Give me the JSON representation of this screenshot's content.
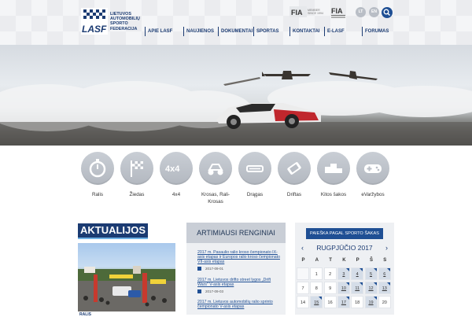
{
  "header": {
    "logo_text": "LASF",
    "org_lines": [
      "LIETUVOS",
      "AUTOMOBILIŲ",
      "SPORTO",
      "FEDERACIJA"
    ],
    "fia_member_lines": [
      "MEMBER",
      "SINCE 1994"
    ],
    "fia_logo_text": "FIA",
    "lang": [
      "LT",
      "EN"
    ],
    "nav": [
      "APIE LASF",
      "NAUJIENOS",
      "DOKUMENTAI",
      "SPORTAS",
      "KONTAKTAI",
      "E-LASF",
      "FORUMAS"
    ]
  },
  "categories": [
    "Ralis",
    "Žiedas",
    "4x4",
    "Krosas, Rali-Krosas",
    "Drągas",
    "Driftas",
    "Kitos šakos",
    "eVaržybos"
  ],
  "category_icon_text": {
    "four_by_four": "4x4"
  },
  "news": {
    "title": "AKTUALIJOS",
    "caption": "RALIS"
  },
  "events": {
    "title": "ARTIMIAUSI RENGINIAI",
    "items": [
      {
        "title": "2017 m. Pasaulio ralio kroso čempionato IX-asis etapas ir Europos ralio kroso čempionato VII-asis etapas",
        "date": "2017-09-01"
      },
      {
        "title": "2017 m. Lietuvos drifto street lygos „Drift Wars\" V-asis etapas",
        "date": "2017-09-03"
      },
      {
        "title": "2017 m. Lietuvos automobilių ralio sprinto čempionato V-asis etapas",
        "date": ""
      }
    ]
  },
  "calendar": {
    "search_button": "PAIEŠKA PAGAL SPORTO ŠAKAS",
    "month": "RUGPJŪČIO 2017",
    "prev": "‹",
    "next": "›",
    "dow": [
      "P",
      "A",
      "T",
      "K",
      "P",
      "Š",
      "S"
    ],
    "rows": [
      [
        "",
        "1",
        "2",
        "3",
        "4",
        "5",
        "6"
      ],
      [
        "7",
        "8",
        "9",
        "10",
        "11",
        "12",
        "13"
      ],
      [
        "14",
        "15",
        "16",
        "17",
        "18",
        "19",
        "20"
      ]
    ],
    "event_days": [
      "3",
      "4",
      "5",
      "6",
      "10",
      "11",
      "12",
      "13",
      "15",
      "17",
      "19"
    ]
  }
}
